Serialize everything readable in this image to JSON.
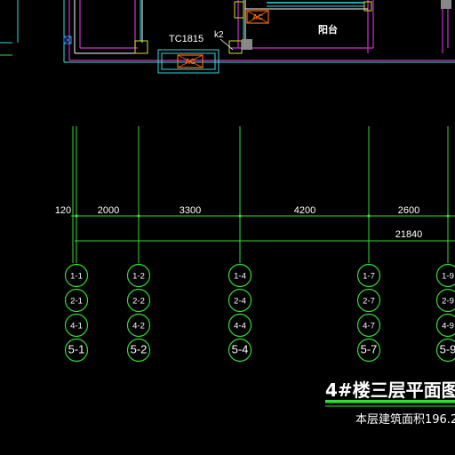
{
  "colors": {
    "background": "#000000",
    "dimension_line": "#33dd33",
    "wall": "#cc33cc",
    "window": "#33dddd",
    "axis_bubble": "#33dd33",
    "accent_ac": "#ff6600",
    "text_white": "#ffffff",
    "gray_marker": "#888888",
    "title_underline": "#33dd33"
  },
  "plan": {
    "window_label": "TC1815",
    "k_label": "k2",
    "balcony_label": "阳台",
    "ac_label": "AC"
  },
  "dimensions": {
    "segments": [
      "120",
      "2000",
      "3300",
      "4200",
      "2600"
    ],
    "total": "21840"
  },
  "axes": [
    {
      "labels": [
        "1-1",
        "2-1",
        "4-1",
        "5-1"
      ]
    },
    {
      "labels": [
        "1-2",
        "2-2",
        "4-2",
        "5-2"
      ]
    },
    {
      "labels": [
        "1-4",
        "2-4",
        "4-4",
        "5-4"
      ]
    },
    {
      "labels": [
        "1-7",
        "2-7",
        "4-7",
        "5-7"
      ]
    },
    {
      "labels": [
        "1-9",
        "2-9",
        "4-9",
        "5-9"
      ]
    }
  ],
  "title": {
    "main": "4#楼三层平面图",
    "subtitle": "本层建筑面积196.2"
  }
}
